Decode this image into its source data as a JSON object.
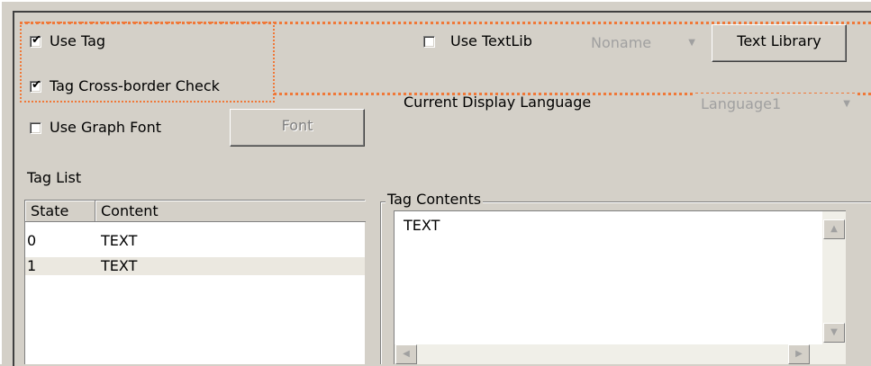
{
  "options": {
    "use_tag": {
      "label": "Use Tag",
      "checked": true
    },
    "tag_cross_border_check": {
      "label": "Tag Cross-border Check",
      "checked": true
    },
    "use_graph_font": {
      "label": "Use Graph Font",
      "checked": false
    },
    "font_button": "Font",
    "use_textlib": {
      "label": "Use TextLib",
      "checked": false
    },
    "textlib_select": "Noname",
    "text_library_button": "Text Library",
    "current_display_language_label": "Current Display Language",
    "language_select": "Language1"
  },
  "tag_list": {
    "label": "Tag List",
    "columns": [
      "State",
      "Content"
    ],
    "rows": [
      {
        "state": "0",
        "content": "TEXT"
      },
      {
        "state": "1",
        "content": "TEXT"
      }
    ]
  },
  "tag_contents": {
    "title": "Tag Contents",
    "text": "TEXT"
  },
  "icons": {
    "check": "check-icon",
    "dropdown": "chevron-down-icon",
    "scroll_up": "chevron-up-icon",
    "scroll_down": "chevron-down-icon",
    "scroll_left": "chevron-left-icon",
    "scroll_right": "chevron-right-icon"
  },
  "colors": {
    "dialog_bg": "#d4d0c8",
    "highlight_dots": "#f07838",
    "disabled_text": "#a0a0a0"
  }
}
